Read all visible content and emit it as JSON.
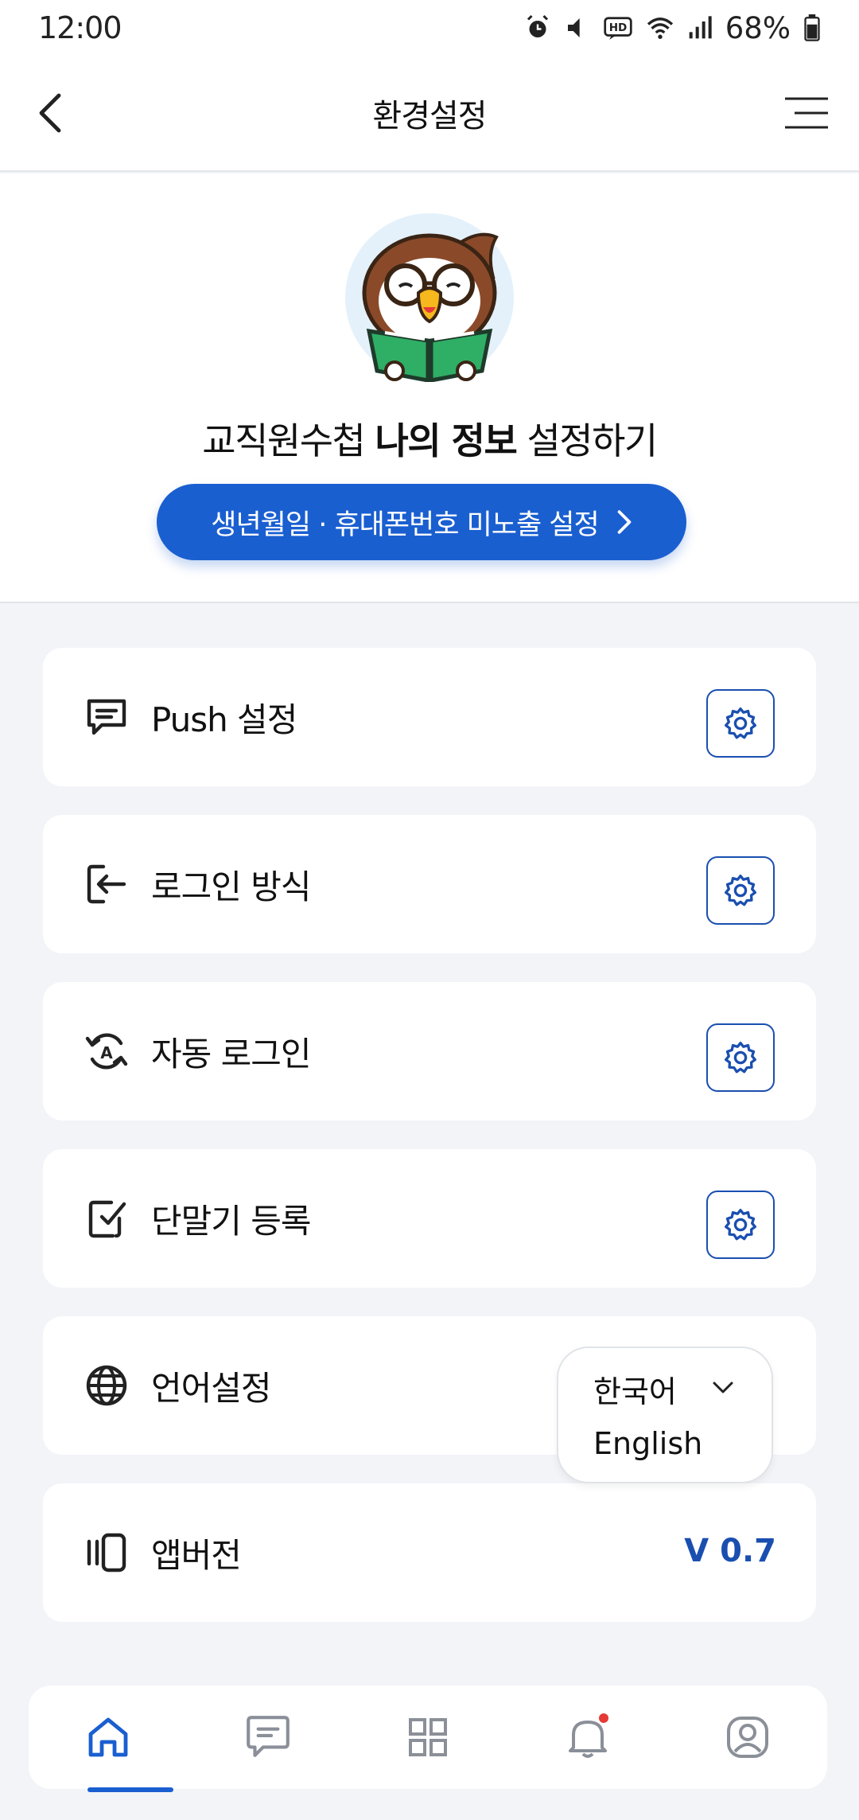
{
  "status_bar": {
    "time": "12:00",
    "battery": "68%"
  },
  "header": {
    "title": "환경설정"
  },
  "profile": {
    "heading_prefix": "교직원수첩",
    "heading_bold": "나의 정보",
    "heading_suffix": "설정하기",
    "privacy_button": "생년월일 · 휴대폰번호 미노출 설정"
  },
  "settings": [
    {
      "label": "Push 설정",
      "icon": "chat-icon"
    },
    {
      "label": "로그인 방식",
      "icon": "login-icon"
    },
    {
      "label": "자동 로그인",
      "icon": "auto-login-icon"
    },
    {
      "label": "단말기 등록",
      "icon": "device-register-icon"
    },
    {
      "label": "언어설정",
      "icon": "globe-icon"
    },
    {
      "label": "앱버전",
      "icon": "app-version-icon"
    }
  ],
  "language": {
    "selected": "한국어",
    "options": [
      "English"
    ]
  },
  "app_version": "V 0.7",
  "colors": {
    "accent": "#1a5fd0",
    "gear_border": "#1a4fb0",
    "background": "#f2f4f8"
  },
  "bottom_nav": [
    "home-icon",
    "message-icon",
    "grid-icon",
    "bell-icon",
    "profile-icon"
  ]
}
